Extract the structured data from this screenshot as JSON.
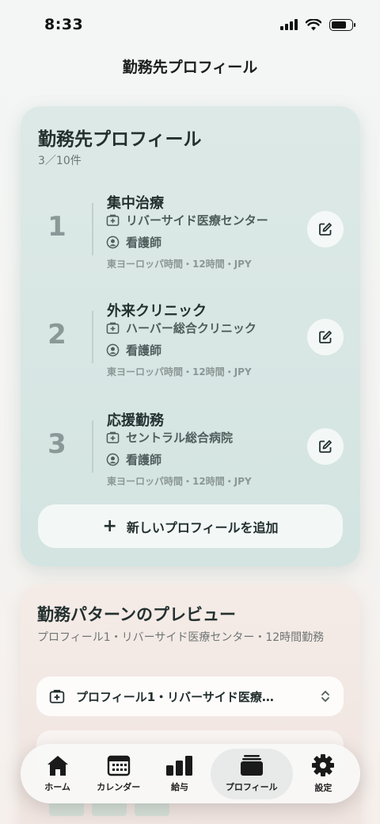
{
  "status": {
    "time": "8:33"
  },
  "nav": {
    "title": "勤務先プロフィール"
  },
  "profiles_card": {
    "title": "勤務先プロフィール",
    "count": "3／10件",
    "items": [
      {
        "number": "1",
        "name": "集中治療",
        "facility": "リバーサイド医療センター",
        "role": "看護師",
        "meta": "東ヨーロッパ時間・12時間・JPY"
      },
      {
        "number": "2",
        "name": "外来クリニック",
        "facility": "ハーバー総合クリニック",
        "role": "看護師",
        "meta": "東ヨーロッパ時間・12時間・JPY"
      },
      {
        "number": "3",
        "name": "応援勤務",
        "facility": "セントラル総合病院",
        "role": "看護師",
        "meta": "東ヨーロッパ時間・12時間・JPY"
      }
    ],
    "add_button": "新しいプロフィールを追加"
  },
  "preview_card": {
    "title": "勤務パターンのプレビュー",
    "subtitle": "プロフィール1・リバーサイド医療センター・12時間勤務",
    "select_value": "プロフィール1・リバーサイド医療…"
  },
  "tabs": [
    {
      "label": "ホーム",
      "icon": "house-icon"
    },
    {
      "label": "カレンダー",
      "icon": "calendar-icon"
    },
    {
      "label": "給与",
      "icon": "bar-chart-icon"
    },
    {
      "label": "プロフィール",
      "icon": "stack-icon",
      "active": true
    },
    {
      "label": "設定",
      "icon": "gear-icon"
    }
  ],
  "colors": {
    "accent": "#23302f",
    "card_bg": "#d8e6e4",
    "preview_bg": "#f2e7e2"
  }
}
